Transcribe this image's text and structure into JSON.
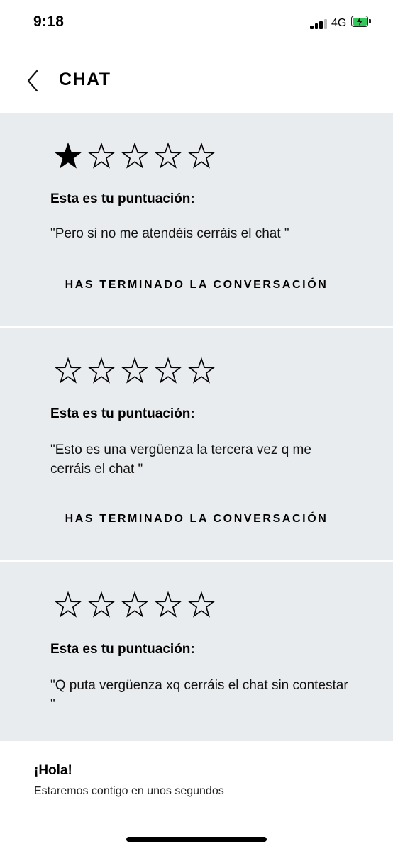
{
  "status_bar": {
    "time": "9:18",
    "network": "4G"
  },
  "header": {
    "title": "CHAT"
  },
  "ratings": [
    {
      "stars": 1,
      "label": "Esta es tu puntuación:",
      "comment": "\"Pero si no me atendéis cerráis el chat \"",
      "ended": "HAS TERMINADO LA CONVERSACIÓN"
    },
    {
      "stars": 0,
      "label": "Esta es tu puntuación:",
      "comment": "\"Esto es una vergüenza la tercera vez q me cerráis el chat \"",
      "ended": "HAS TERMINADO LA CONVERSACIÓN"
    },
    {
      "stars": 0,
      "label": "Esta es tu puntuación:",
      "comment": "\"Q puta vergüenza xq cerráis el chat sin contestar \""
    }
  ],
  "footer": {
    "title": "¡Hola!",
    "subtitle": "Estaremos contigo en unos segundos"
  },
  "colors": {
    "card_bg": "#e9ecef",
    "battery": "#34c759"
  },
  "icons": {
    "back": "chevron-left-icon",
    "star_filled": "star-filled-icon",
    "star_empty": "star-outline-icon"
  }
}
